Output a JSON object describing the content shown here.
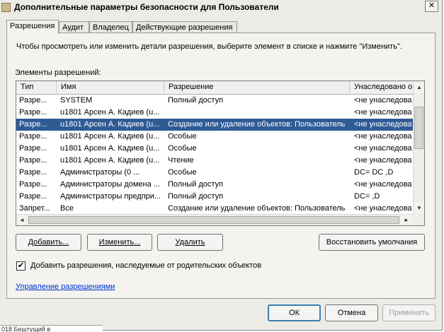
{
  "window": {
    "title": "Дополнительные параметры безопасности для Пользователи",
    "close_label": "✕"
  },
  "tabs": [
    {
      "label": "Разрешения",
      "active": true
    },
    {
      "label": "Аудит",
      "active": false
    },
    {
      "label": "Владелец",
      "active": false
    },
    {
      "label": "Действующие разрешения",
      "active": false
    }
  ],
  "instructions": "Чтобы просмотреть или изменить детали разрешения, выберите элемент в списке и нажмите \"Изменить\".",
  "list_label": "Элементы разрешений:",
  "columns": [
    "Тип",
    "Имя",
    "Разрешение",
    "Унаследовано о"
  ],
  "rows": [
    [
      "Разре...",
      "SYSTEM",
      "Полный доступ",
      "<не унаследова"
    ],
    [
      "Разре...",
      "u1801 Арсен А. Кадиев (u...",
      "",
      "<не унаследова"
    ],
    [
      "Разре...",
      "u1801 Арсен А. Кадиев (u...",
      "Создание или удаление объектов: Пользователь",
      "<не унаследова"
    ],
    [
      "Разре...",
      "u1801 Арсен А. Кадиев (u...",
      "Особые",
      "<не унаследова"
    ],
    [
      "Разре...",
      "u1801 Арсен А. Кадиев (u...",
      "Особые",
      "<не унаследова"
    ],
    [
      "Разре...",
      "u1801 Арсен А. Кадиев (u...",
      "Чтение",
      "<не унаследова"
    ],
    [
      "Разре...",
      "Администраторы (0        ...",
      "Особые",
      "DC=  DC   ,D"
    ],
    [
      "Разре...",
      "Администраторы домена ...",
      "Полный доступ",
      "<не унаследова"
    ],
    [
      "Разре...",
      "Администраторы предпри...",
      "Полный доступ",
      "DC=      ,D"
    ],
    [
      "Запрет...",
      "Все",
      "Создание или удаление объектов: Пользователь",
      "<не унаследова"
    ]
  ],
  "selected_row": 2,
  "buttons": {
    "add": "Добавить...",
    "edit": "Изменить...",
    "remove": "Удалить",
    "restore": "Восстановить умолчания",
    "ok": "ОК",
    "cancel": "Отмена",
    "apply": "Применить"
  },
  "inherit_checkbox": {
    "label": "Добавить разрешения, наследуемые от родительских объектов",
    "checked": true,
    "mark": "✔"
  },
  "manage_link": "Управление разрешениями",
  "taskbar_text": "018 Бештущий в",
  "icons": {
    "scroll_up": "▲",
    "scroll_down": "▼",
    "scroll_left": "◄",
    "scroll_right": "►"
  },
  "colors": {
    "selection": "#2f5b95",
    "link": "#0033cc",
    "default_button_border": "#3c7fb1"
  }
}
